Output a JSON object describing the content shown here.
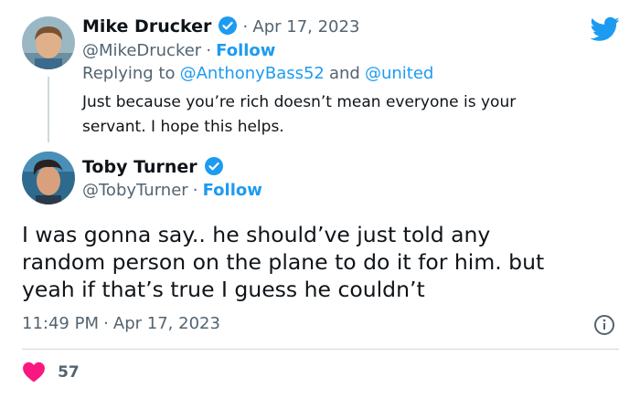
{
  "reply_tweet": {
    "author_name": "Mike Drucker",
    "handle": "@MikeDrucker",
    "date": "Apr 17, 2023",
    "follow_label": "Follow",
    "replying_prefix": "Replying to",
    "replying_user1": "@AnthonyBass52",
    "replying_and": "and",
    "replying_user2": "@united",
    "text_line1": "Just because you’re rich doesn’t mean everyone is your",
    "text_line2": "servant. I hope this helps."
  },
  "main_tweet": {
    "author_name": "Toby Turner",
    "handle": "@TobyTurner",
    "follow_label": "Follow",
    "text_line1": "I was gonna say.. he should’ve just told any",
    "text_line2": "random person on the plane to do it for him.  but",
    "text_line3": "yeah if that’s true I guess he couldn’t",
    "time": "11:49 PM",
    "date": "Apr 17, 2023",
    "likes": "57"
  },
  "separators": {
    "dot": "·"
  },
  "icons": {
    "brand": "twitter-bird-icon",
    "verified": "verified-badge-icon",
    "info": "info-icon",
    "like": "heart-icon"
  },
  "colors": {
    "accent": "#1d9bf0",
    "like": "#f91880",
    "secondary_text": "#536471"
  }
}
